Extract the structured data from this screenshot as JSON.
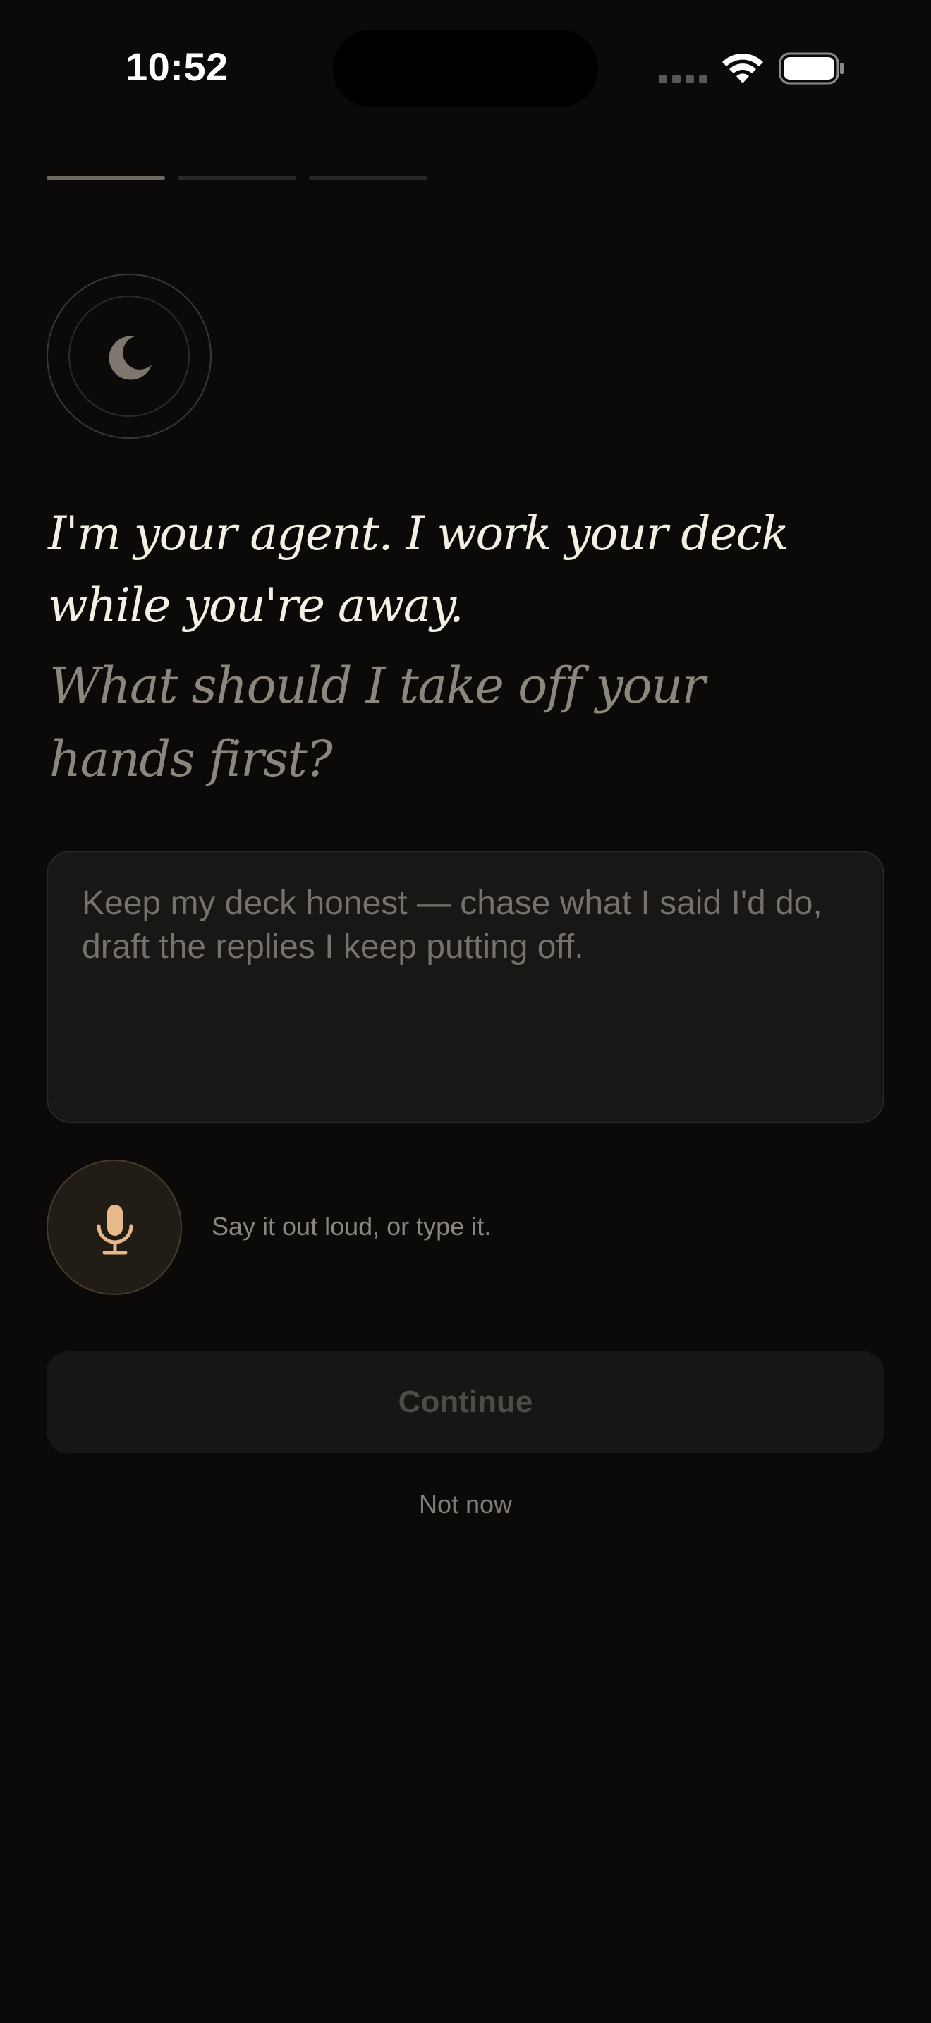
{
  "status_bar": {
    "time": "10:52"
  },
  "onboarding": {
    "steps_total": 3,
    "current_step": 1
  },
  "emblem": {
    "icon": "moon-icon"
  },
  "headline": "I'm your agent. I work your deck while you're away.",
  "subheadline": "What should I take off your hands first?",
  "input": {
    "placeholder": "Keep my deck honest — chase what I said I'd do, draft the replies I keep putting off.",
    "value": ""
  },
  "mic": {
    "icon": "microphone-icon",
    "hint": "Say it out loud, or type it."
  },
  "actions": {
    "continue_label": "Continue",
    "dismiss_label": "Not now"
  },
  "colors": {
    "background": "#0b0a09",
    "accent": "#e7b98a",
    "text_primary": "#f4eee3",
    "text_secondary": "#8c867c"
  }
}
